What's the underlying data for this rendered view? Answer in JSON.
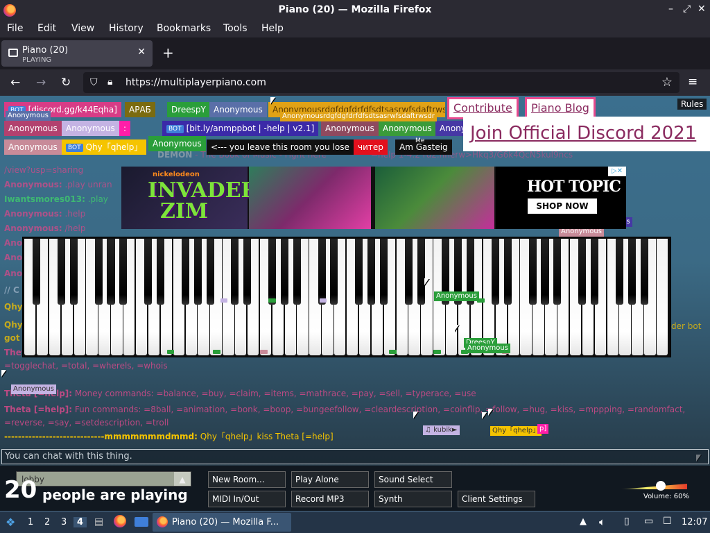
{
  "window": {
    "title": "Piano (20) — Mozilla Firefox",
    "controls": [
      "–",
      "⤢",
      "✕"
    ]
  },
  "menu": [
    "File",
    "Edit",
    "View",
    "History",
    "Bookmarks",
    "Tools",
    "Help"
  ],
  "tab": {
    "title": "Piano (20)",
    "status": "PLAYING",
    "close": "✕",
    "new_tab": "+"
  },
  "nav": {
    "url": "https://multiplayerpiano.com"
  },
  "page": {
    "rules": "Rules",
    "links": {
      "contribute": "Contribute",
      "blog": "Piano Blog",
      "discord": "Join Official Discord 2021"
    },
    "users_row1": [
      {
        "label": "[discord.gg/k44Eqha]",
        "bot": "BOT",
        "color": "#d73c86"
      },
      {
        "label": "АРАБ",
        "color": "#7b6b10"
      },
      {
        "label": "DreesрY",
        "color": "#2a9e3a"
      },
      {
        "label": "Anonymous",
        "color": "#5a6fa8"
      },
      {
        "label": "Anonymousrdgfdgfdrfdfsdtsasrwfsdaftrwsdr",
        "color": "#e0a216"
      }
    ],
    "users_row2": [
      {
        "label": "Anonymous",
        "color": "#b2416f"
      },
      {
        "label": "Anonymous",
        "color": "#c4b3e3"
      },
      {
        "label": ":",
        "color": "#ff1ea8"
      },
      {
        "label": "[bit.ly/anmppbot | -help | v2.1]",
        "bot": "BOT",
        "color": "#3b2aa8"
      },
      {
        "label": "Anonymous",
        "color": "#8e4a5f"
      },
      {
        "label": "Anonymous",
        "color": "#3a9b3a"
      },
      {
        "label": "Anony",
        "color": "#4638a5"
      }
    ],
    "users_row3": [
      {
        "label": "Anonymous",
        "color": "#c88b99"
      },
      {
        "label": "Qhy「qhelp」",
        "bot": "BOT",
        "color": "#f5c400"
      },
      {
        "label": "Anonymous",
        "color": "#2a9e3a"
      },
      {
        "label": "<--- you leave this room you lose",
        "color": "#111111"
      },
      {
        "label": "читер",
        "color": "#e3101d"
      },
      {
        "label": "Am Gasteig",
        "color": "#111111"
      }
    ],
    "floating_tags": {
      "anon_top": "Anonymous",
      "anon_long2": "Anonymousrdgfdgfdrfdfsdtsasrwfsdaftrwsdr",
      "me": "Me",
      "demon": "DEMON",
      "piano_anon_left": "Anonymous",
      "piano_anon_mid": "Anonymous",
      "piano_dreesry": "DreesрY",
      "piano_anon_low": "Anonymous",
      "anon_side": "Anonymous",
      "us_frag": "us",
      "kubik": "♫ kubik►",
      "qhy": "Qhy「qhelp」",
      "p_frag": "p]"
    },
    "chat": [
      {
        "name": "",
        "msg": "/view?usp=sharing",
        "color": "#d44a8a"
      },
      {
        "name": "Anonymous:",
        "msg": " .play unran",
        "color": "#d44a8a"
      },
      {
        "name": "Iwantsmores013:",
        "msg": " .play",
        "color": "#3fd36b"
      },
      {
        "name": "Anonymous:",
        "msg": " .help",
        "color": "#d44a8a"
      },
      {
        "name": "Anonymous:",
        "msg": " /help",
        "color": "#d44a8a"
      },
      {
        "name": "Anor",
        "msg": "",
        "color": "#d44a8a"
      },
      {
        "name": "Anor",
        "msg": "",
        "color": "#d44a8a"
      },
      {
        "name": "Anor",
        "msg": "",
        "color": "#d44a8a"
      },
      {
        "name": "// C",
        "msg": "",
        "color": "#9fb3c8"
      },
      {
        "name": "Qhy",
        "msg": "",
        "color": "#f5c400"
      },
      {
        "name": "Qhy",
        "msg": "",
        "color": "#f5c400"
      },
      {
        "name": "got",
        "msg": "",
        "color": "#f5c400"
      },
      {
        "name": "Theta [=help]:",
        "msg": "  Utility commands: =leftcr, =bitstand, =help, =id, =isonline, =leaderboard, =namehistory, =petstatavg, =roominfo, =stats, =stop, =suggest, =togglechat, =total, =wherels, =whois",
        "color": "#d44a8a"
      },
      {
        "name": "Theta [=help]:",
        "msg": "  Money commands: =balance, =buy, =claim, =items, =mathrace, =pay, =sell, =typerace, =use",
        "color": "#d44a8a"
      },
      {
        "name": "Theta [=help]:",
        "msg": "  Fun commands: =8ball, =animation, =bonk, =boop, =bungeefollow, =cleardescription, =coinflip, =follow, =hug, =kiss, =mppping, =randomfact, =reverse, =say, =setdescription, =troll",
        "color": "#d44a8a"
      },
      {
        "name": "-----------------------------mmmmmmmdmmd:",
        "msg": " Qhy「qhelp」kiss Theta [=help]",
        "color": "#f5c400"
      }
    ],
    "chat_fragment_right": "der bot",
    "chat_fragment_mid": "=nelp 1-4.2 ru2.nnerw>Hkq3/G6k4QcN5kul9ncs",
    "demon_text": "- The Book of Music - Fight here",
    "chat_placeholder": "You can chat with this thing.",
    "ad": {
      "brand": "nickelodeon",
      "show_line1": "INVADER",
      "show_line2": "ZIM",
      "store": "HOT TOPIC",
      "cta": "SHOP NOW",
      "badge": "▷✕"
    },
    "piano": {
      "white_keys": 52,
      "black_key_color": "#000000",
      "white_key_color": "#ffffff"
    },
    "controls": {
      "room": "lobby",
      "count": "20",
      "count_label": "people are playing",
      "buttons_top": [
        "New Room...",
        "Play Alone",
        "Sound Select"
      ],
      "buttons_bottom": [
        "MIDI In/Out",
        "Record MP3",
        "Synth",
        "Client Settings"
      ],
      "volume_label": "Volume: 60%",
      "volume_value": 0.6
    }
  },
  "taskbar": {
    "workspaces": [
      "1",
      "2",
      "3",
      "4"
    ],
    "active_task": "Piano (20) — Mozilla F...",
    "clock": "12:07"
  }
}
